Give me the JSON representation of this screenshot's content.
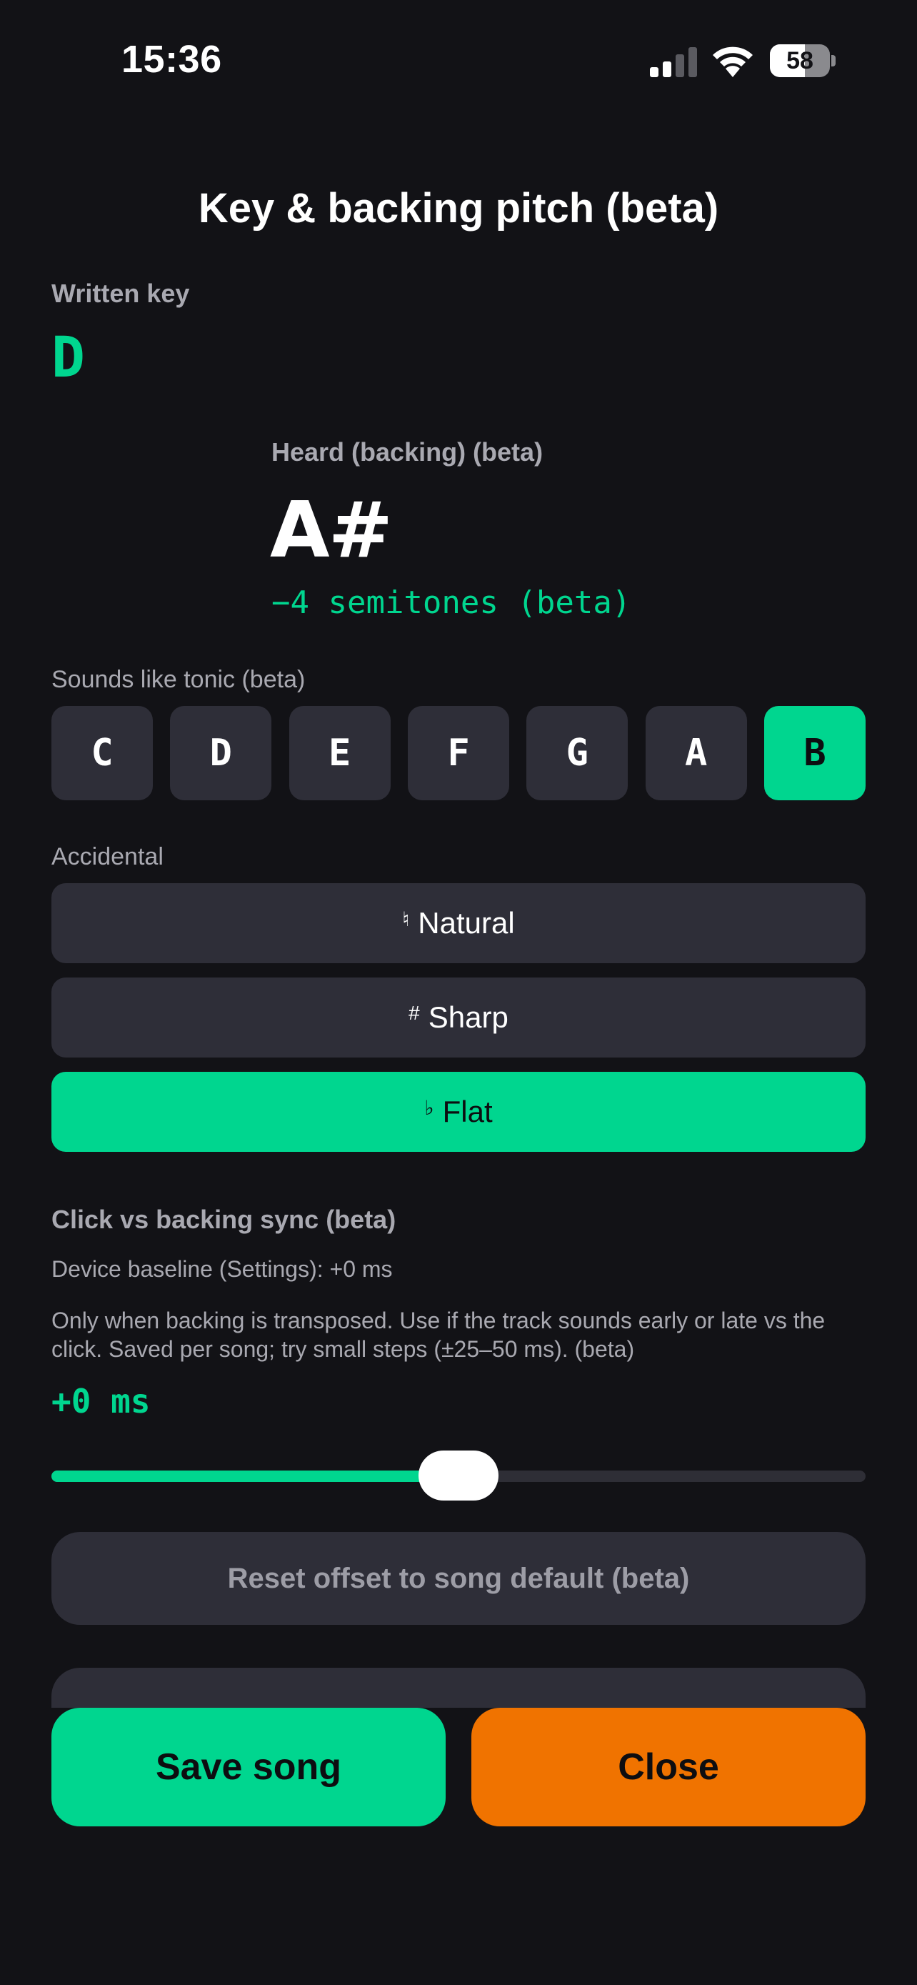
{
  "status_bar": {
    "time": "15:36",
    "battery_percent": "58",
    "battery_level": 0.58,
    "signal_bars_active": 2,
    "signal_bars_total": 4
  },
  "colors": {
    "accent_green": "#00d68f",
    "close_orange": "#f07300",
    "background": "#121216",
    "button_grey": "#2e2e38"
  },
  "sheet": {
    "title": "Key & backing pitch (beta)"
  },
  "written_key": {
    "label": "Written key",
    "value": "D"
  },
  "heard_key": {
    "label": "Heard (backing) (beta)",
    "value": "A#",
    "semitones": "−4 semitones (beta)"
  },
  "tonic": {
    "label": "Sounds like tonic (beta)",
    "options": [
      "C",
      "D",
      "E",
      "F",
      "G",
      "A",
      "B"
    ],
    "selected": "B"
  },
  "accidental": {
    "label": "Accidental",
    "options": [
      {
        "symbol": "♮",
        "label": "Natural",
        "selected": false
      },
      {
        "symbol": "#",
        "label": "Sharp",
        "selected": false
      },
      {
        "symbol": "♭",
        "label": "Flat",
        "selected": true
      }
    ]
  },
  "sync": {
    "title": "Click vs backing sync (beta)",
    "baseline": "Device baseline (Settings): +0 ms",
    "description": "Only when backing is transposed. Use if the track sounds early or late vs the click. Saved per song; try small steps (±25–50 ms). (beta)",
    "offset_value": "+0 ms",
    "slider_position": 0.5,
    "reset_label": "Reset offset to song default (beta)"
  },
  "footer": {
    "save_label": "Save song",
    "close_label": "Close"
  }
}
